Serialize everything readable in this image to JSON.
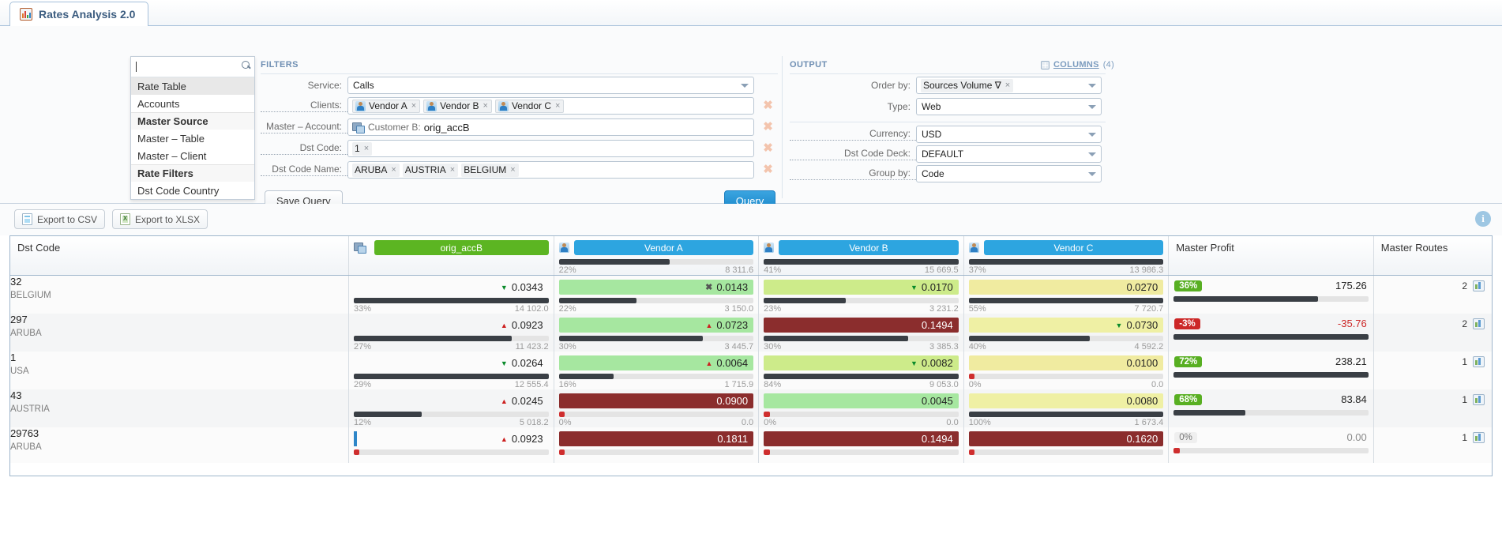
{
  "tab": {
    "title": "Rates Analysis 2.0",
    "icon": "chart-document-icon"
  },
  "suggest": {
    "input_value": "",
    "items": [
      {
        "label": "Rate Table",
        "type": "item",
        "highlighted": true
      },
      {
        "label": "Accounts",
        "type": "item",
        "highlighted": false
      },
      {
        "label": "Master Source",
        "type": "group",
        "highlighted": false
      },
      {
        "label": "Master – Table",
        "type": "item",
        "highlighted": false
      },
      {
        "label": "Master – Client",
        "type": "item",
        "highlighted": false
      },
      {
        "label": "Rate Filters",
        "type": "group",
        "highlighted": false
      },
      {
        "label": "Dst Code Country",
        "type": "item",
        "highlighted": false
      }
    ]
  },
  "filters": {
    "title": "FILTERS",
    "service": {
      "label": "Service:",
      "value": "Calls"
    },
    "clients": {
      "label": "Clients:",
      "chips": [
        {
          "label": "Vendor A",
          "icon": "user-icon",
          "remove": "×"
        },
        {
          "label": "Vendor B",
          "icon": "user-icon",
          "remove": "×"
        },
        {
          "label": "Vendor C",
          "icon": "user-icon",
          "remove": "×"
        }
      ]
    },
    "master_account": {
      "label": "Master – Account:",
      "icon": "server-icon",
      "prefix": "Customer B:",
      "value": "orig_accB"
    },
    "dst_code": {
      "label": "Dst Code:",
      "chips": [
        {
          "label": "1",
          "remove": "×"
        }
      ]
    },
    "dst_code_name": {
      "label": "Dst Code Name:",
      "chips": [
        {
          "label": "ARUBA",
          "remove": "×"
        },
        {
          "label": "AUSTRIA",
          "remove": "×"
        },
        {
          "label": "BELGIUM",
          "remove": "×"
        }
      ]
    },
    "save_query_label": "Save Query",
    "query_label": "Query"
  },
  "output": {
    "title": "OUTPUT",
    "columns_label": "COLUMNS",
    "columns_count": "(4)",
    "order_by": {
      "label": "Order by:",
      "chip": "Sources Volume ∇",
      "remove": "×"
    },
    "type": {
      "label": "Type:",
      "value": "Web"
    },
    "currency": {
      "label": "Currency:",
      "value": "USD"
    },
    "dst_code_deck": {
      "label": "Dst Code Deck:",
      "value": "DEFAULT"
    },
    "group_by": {
      "label": "Group by:",
      "value": "Code"
    }
  },
  "toolbar": {
    "export_csv": "Export to CSV",
    "export_xlsx": "Export to XLSX",
    "info": "i"
  },
  "table": {
    "columns": [
      {
        "key": "dst_code",
        "label": "Dst Code",
        "kind": "text"
      },
      {
        "key": "orig_accB",
        "label": "orig_accB",
        "kind": "account",
        "pill": "green"
      },
      {
        "key": "vendor_a",
        "label": "Vendor A",
        "kind": "vendor",
        "pill": "blue"
      },
      {
        "key": "vendor_b",
        "label": "Vendor B",
        "kind": "vendor",
        "pill": "blue"
      },
      {
        "key": "vendor_c",
        "label": "Vendor C",
        "kind": "vendor",
        "pill": "blue"
      },
      {
        "key": "master_profit",
        "label": "Master Profit",
        "kind": "profit"
      },
      {
        "key": "master_routes",
        "label": "Master Routes",
        "kind": "routes"
      }
    ],
    "header_meters": {
      "orig_accB": {
        "pct": "",
        "value": "",
        "fill": 0
      },
      "vendor_a": {
        "pct": "22%",
        "value": "8 311.6",
        "fill": 57
      },
      "vendor_b": {
        "pct": "41%",
        "value": "15 669.5",
        "fill": 100
      },
      "vendor_c": {
        "pct": "37%",
        "value": "13 986.3",
        "fill": 100
      }
    },
    "rows": [
      {
        "code": "32",
        "name": "BELGIUM",
        "orig": {
          "rate": "0.0343",
          "trend": "down",
          "box": "none",
          "pct": "33%",
          "value": "14 102.0",
          "fill": 100
        },
        "vendor_a": {
          "rate": "0.0143",
          "trend": "x",
          "box": "g1",
          "pct": "22%",
          "value": "3 150.0",
          "fill": 40
        },
        "vendor_b": {
          "rate": "0.0170",
          "trend": "down",
          "box": "g2",
          "pct": "23%",
          "value": "3 231.2",
          "fill": 42
        },
        "vendor_c": {
          "rate": "0.0270",
          "trend": "",
          "box": "y1",
          "pct": "55%",
          "value": "7 720.7",
          "fill": 100
        },
        "profit": {
          "pct": "36%",
          "value": "175.26",
          "tone": "pos",
          "fill": 74
        },
        "routes": "2"
      },
      {
        "code": "297",
        "name": "ARUBA",
        "orig": {
          "rate": "0.0923",
          "trend": "up",
          "box": "none",
          "pct": "27%",
          "value": "11 423.2",
          "fill": 81
        },
        "vendor_a": {
          "rate": "0.0723",
          "trend": "up",
          "box": "g1",
          "pct": "30%",
          "value": "3 445.7",
          "fill": 74
        },
        "vendor_b": {
          "rate": "0.1494",
          "trend": "",
          "box": "r1",
          "pct": "30%",
          "value": "3 385.3",
          "fill": 74
        },
        "vendor_c": {
          "rate": "0.0730",
          "trend": "down",
          "box": "y2",
          "pct": "40%",
          "value": "4 592.2",
          "fill": 62
        },
        "profit": {
          "pct": "-3%",
          "value": "-35.76",
          "tone": "neg",
          "fill": 100
        },
        "routes": "2"
      },
      {
        "code": "1",
        "name": "USA",
        "orig": {
          "rate": "0.0264",
          "trend": "down",
          "box": "none",
          "pct": "29%",
          "value": "12 555.4",
          "fill": 100
        },
        "vendor_a": {
          "rate": "0.0064",
          "trend": "up",
          "box": "g1",
          "pct": "16%",
          "value": "1 715.9",
          "fill": 28
        },
        "vendor_b": {
          "rate": "0.0082",
          "trend": "down",
          "box": "g2",
          "pct": "84%",
          "value": "9 053.0",
          "fill": 100
        },
        "vendor_c": {
          "rate": "0.0100",
          "trend": "",
          "box": "y1",
          "pct": "0%",
          "value": "0.0",
          "fill": 0
        },
        "profit": {
          "pct": "72%",
          "value": "238.21",
          "tone": "pos",
          "fill": 100
        },
        "routes": "1"
      },
      {
        "code": "43",
        "name": "AUSTRIA",
        "orig": {
          "rate": "0.0245",
          "trend": "up",
          "box": "none",
          "pct": "12%",
          "value": "5 018.2",
          "fill": 35
        },
        "vendor_a": {
          "rate": "0.0900",
          "trend": "",
          "box": "r1",
          "pct": "0%",
          "value": "0.0",
          "fill": 0
        },
        "vendor_b": {
          "rate": "0.0045",
          "trend": "",
          "box": "g1",
          "pct": "0%",
          "value": "0.0",
          "fill": 0
        },
        "vendor_c": {
          "rate": "0.0080",
          "trend": "",
          "box": "y2",
          "pct": "100%",
          "value": "1 673.4",
          "fill": 100
        },
        "profit": {
          "pct": "68%",
          "value": "83.84",
          "tone": "pos",
          "fill": 37
        },
        "routes": "1"
      },
      {
        "code": "29763",
        "name": "ARUBA",
        "orig": {
          "rate": "0.0923",
          "trend": "up",
          "box": "blue-left",
          "pct": "",
          "value": "",
          "fill": 0
        },
        "vendor_a": {
          "rate": "0.1811",
          "trend": "",
          "box": "r1",
          "pct": "",
          "value": "",
          "fill": 0
        },
        "vendor_b": {
          "rate": "0.1494",
          "trend": "",
          "box": "r1",
          "pct": "",
          "value": "",
          "fill": 0
        },
        "vendor_c": {
          "rate": "0.1620",
          "trend": "",
          "box": "r1",
          "pct": "",
          "value": "",
          "fill": 0
        },
        "profit": {
          "pct": "0%",
          "value": "0.00",
          "tone": "zero",
          "fill": 0
        },
        "routes": "1"
      }
    ]
  },
  "colors": {
    "accent": "#2da5e0",
    "green_pill": "#5cb522",
    "positive": "#58af22",
    "negative": "#cc2727",
    "meter": "#3a3f45"
  }
}
